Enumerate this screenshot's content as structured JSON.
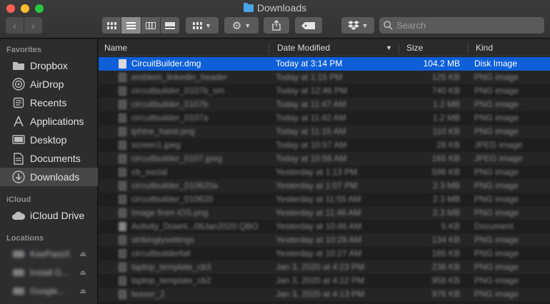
{
  "window": {
    "title": "Downloads"
  },
  "toolbar": {
    "back_icon": "chevron-left-icon",
    "forward_icon": "chevron-right-icon",
    "search_placeholder": "Search"
  },
  "sidebar": {
    "favorites_label": "Favorites",
    "favorites": [
      {
        "label": "Dropbox",
        "icon": "dropbox-icon"
      },
      {
        "label": "AirDrop",
        "icon": "airdrop-icon"
      },
      {
        "label": "Recents",
        "icon": "clock-icon"
      },
      {
        "label": "Applications",
        "icon": "applications-icon"
      },
      {
        "label": "Desktop",
        "icon": "desktop-icon"
      },
      {
        "label": "Documents",
        "icon": "document-icon"
      },
      {
        "label": "Downloads",
        "icon": "download-icon",
        "selected": true
      }
    ],
    "icloud_label": "iCloud",
    "icloud": [
      {
        "label": "iCloud Drive",
        "icon": "cloud-icon"
      }
    ],
    "locations_label": "Locations",
    "locations": [
      {
        "label": "KeePassX"
      },
      {
        "label": "Install G..."
      },
      {
        "label": "Google..."
      }
    ]
  },
  "columns": {
    "name": "Name",
    "date": "Date Modified",
    "size": "Size",
    "kind": "Kind"
  },
  "files": [
    {
      "name": "CircuitBuilder.dmg",
      "date": "Today at 3:14 PM",
      "size": "104.2 MB",
      "kind": "Disk Image"
    },
    {
      "name": "emblem_linkedin_header",
      "date": "Today at 1:15 PM",
      "size": "125 KB",
      "kind": "PNG image"
    },
    {
      "name": "circuitbuilder_0107b_sm",
      "date": "Today at 12:46 PM",
      "size": "740 KB",
      "kind": "PNG image"
    },
    {
      "name": "circuitbuilder_0107b",
      "date": "Today at 11:47 AM",
      "size": "1.2 MB",
      "kind": "PNG image"
    },
    {
      "name": "circuitbuilder_0107a",
      "date": "Today at 11:42 AM",
      "size": "1.2 MB",
      "kind": "PNG image"
    },
    {
      "name": "iphine_hand.png",
      "date": "Today at 11:15 AM",
      "size": "110 KB",
      "kind": "PNG image"
    },
    {
      "name": "screen1.jpeg",
      "date": "Today at 10:57 AM",
      "size": "28 KB",
      "kind": "JPEG image"
    },
    {
      "name": "circuitbuilder_0107.jpeg",
      "date": "Today at 10:56 AM",
      "size": "165 KB",
      "kind": "JPEG image"
    },
    {
      "name": "cb_social",
      "date": "Yesterday at 1:13 PM",
      "size": "596 KB",
      "kind": "PNG image"
    },
    {
      "name": "circuitbuilder_010620a",
      "date": "Yesterday at 1:07 PM",
      "size": "2.3 MB",
      "kind": "PNG image"
    },
    {
      "name": "circuitbuilder_010620",
      "date": "Yesterday at 11:55 AM",
      "size": "2.3 MB",
      "kind": "PNG image"
    },
    {
      "name": "Image from iOS.png",
      "date": "Yesterday at 11:46 AM",
      "size": "2.3 MB",
      "kind": "PNG image"
    },
    {
      "name": "Activity_Downl...06Jan2020.QBO",
      "date": "Yesterday at 10:46 AM",
      "size": "5 KB",
      "kind": "Document"
    },
    {
      "name": "strikinglysettings",
      "date": "Yesterday at 10:28 AM",
      "size": "134 KB",
      "kind": "PNG image"
    },
    {
      "name": "circuitbuilderfail",
      "date": "Yesterday at 10:27 AM",
      "size": "165 KB",
      "kind": "PNG image"
    },
    {
      "name": "laptop_template_cb3",
      "date": "Jan 3, 2020 at 4:23 PM",
      "size": "236 KB",
      "kind": "PNG image"
    },
    {
      "name": "laptop_template_cb2",
      "date": "Jan 3, 2020 at 4:22 PM",
      "size": "958 KB",
      "kind": "PNG image"
    },
    {
      "name": "teaser_2",
      "date": "Jan 3, 2020 at 4:13 PM",
      "size": "976 KB",
      "kind": "PNG image"
    }
  ],
  "colors": {
    "selection": "#0e5fd8",
    "sidebar_selected": "#464648"
  }
}
